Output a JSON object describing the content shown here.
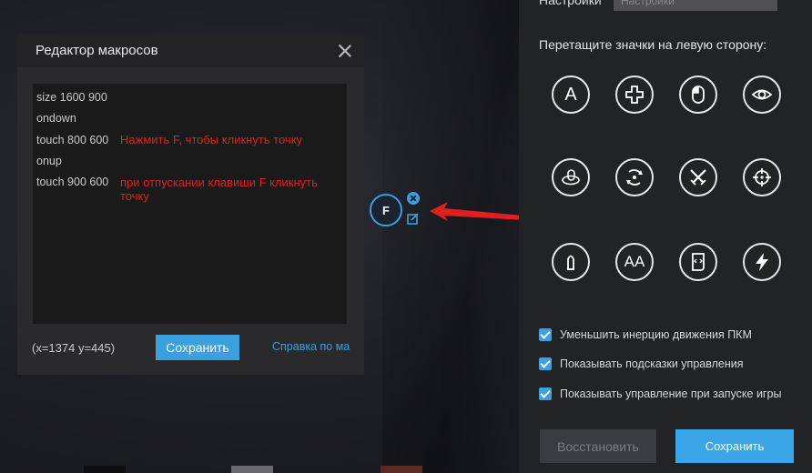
{
  "editor": {
    "title": "Редактор макросов",
    "code_lines": [
      "size 1600 900",
      "ondown",
      "touch 800 600",
      "onup",
      "touch 900 600"
    ],
    "notes": [
      "Нажмить F, чтобы кликнуть точку",
      "при отпускании клавиши F кликнуть точку"
    ],
    "coords": "(x=1374  y=445)",
    "save_label": "Сохранить",
    "help_label": "Справка по ма"
  },
  "marker": {
    "key": "F"
  },
  "panel": {
    "top_label": "Настройки",
    "top_field": "Настройки",
    "instruction": "Перетащите значки на левую сторону:",
    "icons": [
      {
        "name": "text-a-icon",
        "text": "A"
      },
      {
        "name": "dpad-icon"
      },
      {
        "name": "mouse-icon"
      },
      {
        "name": "eye-icon"
      },
      {
        "name": "rotate-mouse-icon"
      },
      {
        "name": "rotate-view-icon"
      },
      {
        "name": "crossed-swords-icon"
      },
      {
        "name": "crosshair-icon"
      },
      {
        "name": "bullet-icon"
      },
      {
        "name": "text-aa-icon",
        "text": "AA"
      },
      {
        "name": "script-icon"
      },
      {
        "name": "lightning-icon"
      }
    ],
    "checkboxes": [
      {
        "label": "Уменьшить инерцию движения ПКМ",
        "checked": true
      },
      {
        "label": "Показывать подсказки управления",
        "checked": true
      },
      {
        "label": "Показывать управление при запуске игры",
        "checked": true
      }
    ],
    "restore_label": "Восстановить",
    "save_label": "Сохранить"
  },
  "colors": {
    "accent": "#3aa0e0",
    "note": "#e02020"
  }
}
